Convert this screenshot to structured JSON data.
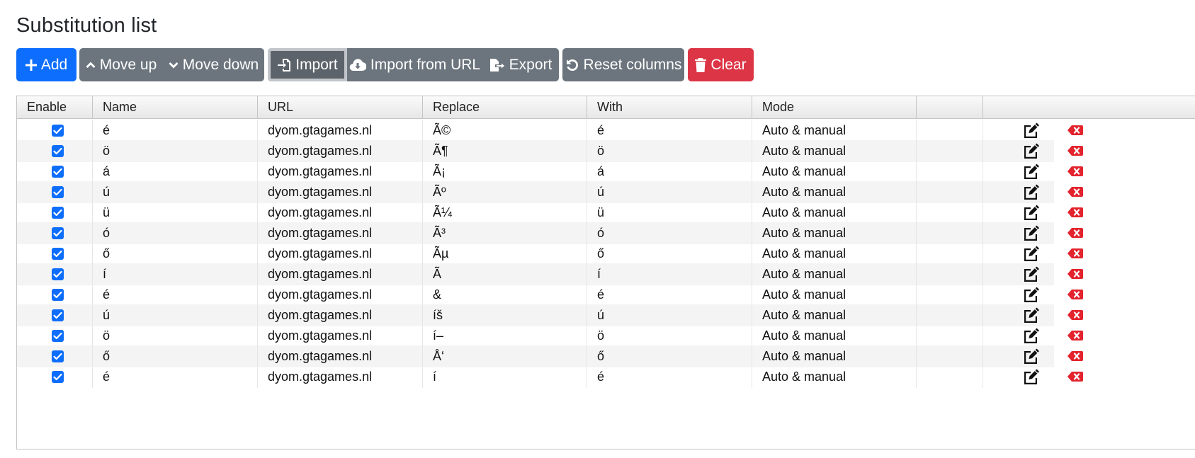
{
  "page": {
    "title": "Substitution list"
  },
  "toolbar": {
    "add": "Add",
    "move_up": "Move up",
    "move_down": "Move down",
    "import": "Import",
    "import_url": "Import from URL",
    "export": "Export",
    "reset_columns": "Reset columns",
    "clear": "Clear"
  },
  "colors": {
    "primary": "#0d6efd",
    "secondary": "#6c757d",
    "danger": "#dc3545"
  },
  "table": {
    "headers": [
      "Enable",
      "Name",
      "URL",
      "Replace",
      "With",
      "Mode",
      ""
    ],
    "rows": [
      {
        "enabled": true,
        "name": "é",
        "url": "dyom.gtagames.nl",
        "replace": "Ã©",
        "with": "é",
        "mode": "Auto & manual"
      },
      {
        "enabled": true,
        "name": "ö",
        "url": "dyom.gtagames.nl",
        "replace": "Ã¶",
        "with": "ö",
        "mode": "Auto & manual"
      },
      {
        "enabled": true,
        "name": "á",
        "url": "dyom.gtagames.nl",
        "replace": "Ã¡",
        "with": "á",
        "mode": "Auto & manual"
      },
      {
        "enabled": true,
        "name": "ú",
        "url": "dyom.gtagames.nl",
        "replace": "Ãº",
        "with": "ú",
        "mode": "Auto & manual"
      },
      {
        "enabled": true,
        "name": "ü",
        "url": "dyom.gtagames.nl",
        "replace": "Ã¼",
        "with": "ü",
        "mode": "Auto & manual"
      },
      {
        "enabled": true,
        "name": "ó",
        "url": "dyom.gtagames.nl",
        "replace": "Ã³",
        "with": "ó",
        "mode": "Auto & manual"
      },
      {
        "enabled": true,
        "name": "ő",
        "url": "dyom.gtagames.nl",
        "replace": "Ãµ",
        "with": "ő",
        "mode": "Auto & manual"
      },
      {
        "enabled": true,
        "name": "í",
        "url": "dyom.gtagames.nl",
        "replace": "Ã",
        "with": "í",
        "mode": "Auto & manual"
      },
      {
        "enabled": true,
        "name": "é",
        "url": "dyom.gtagames.nl",
        "replace": "&",
        "with": "é",
        "mode": "Auto & manual"
      },
      {
        "enabled": true,
        "name": "ú",
        "url": "dyom.gtagames.nl",
        "replace": "íš",
        "with": "ú",
        "mode": "Auto & manual"
      },
      {
        "enabled": true,
        "name": "ö",
        "url": "dyom.gtagames.nl",
        "replace": "í–",
        "with": "ö",
        "mode": "Auto & manual"
      },
      {
        "enabled": true,
        "name": "ő",
        "url": "dyom.gtagames.nl",
        "replace": "Å‘",
        "with": "ő",
        "mode": "Auto & manual"
      },
      {
        "enabled": true,
        "name": "é",
        "url": "dyom.gtagames.nl",
        "replace": "í",
        "with": "é",
        "mode": "Auto & manual"
      }
    ]
  }
}
